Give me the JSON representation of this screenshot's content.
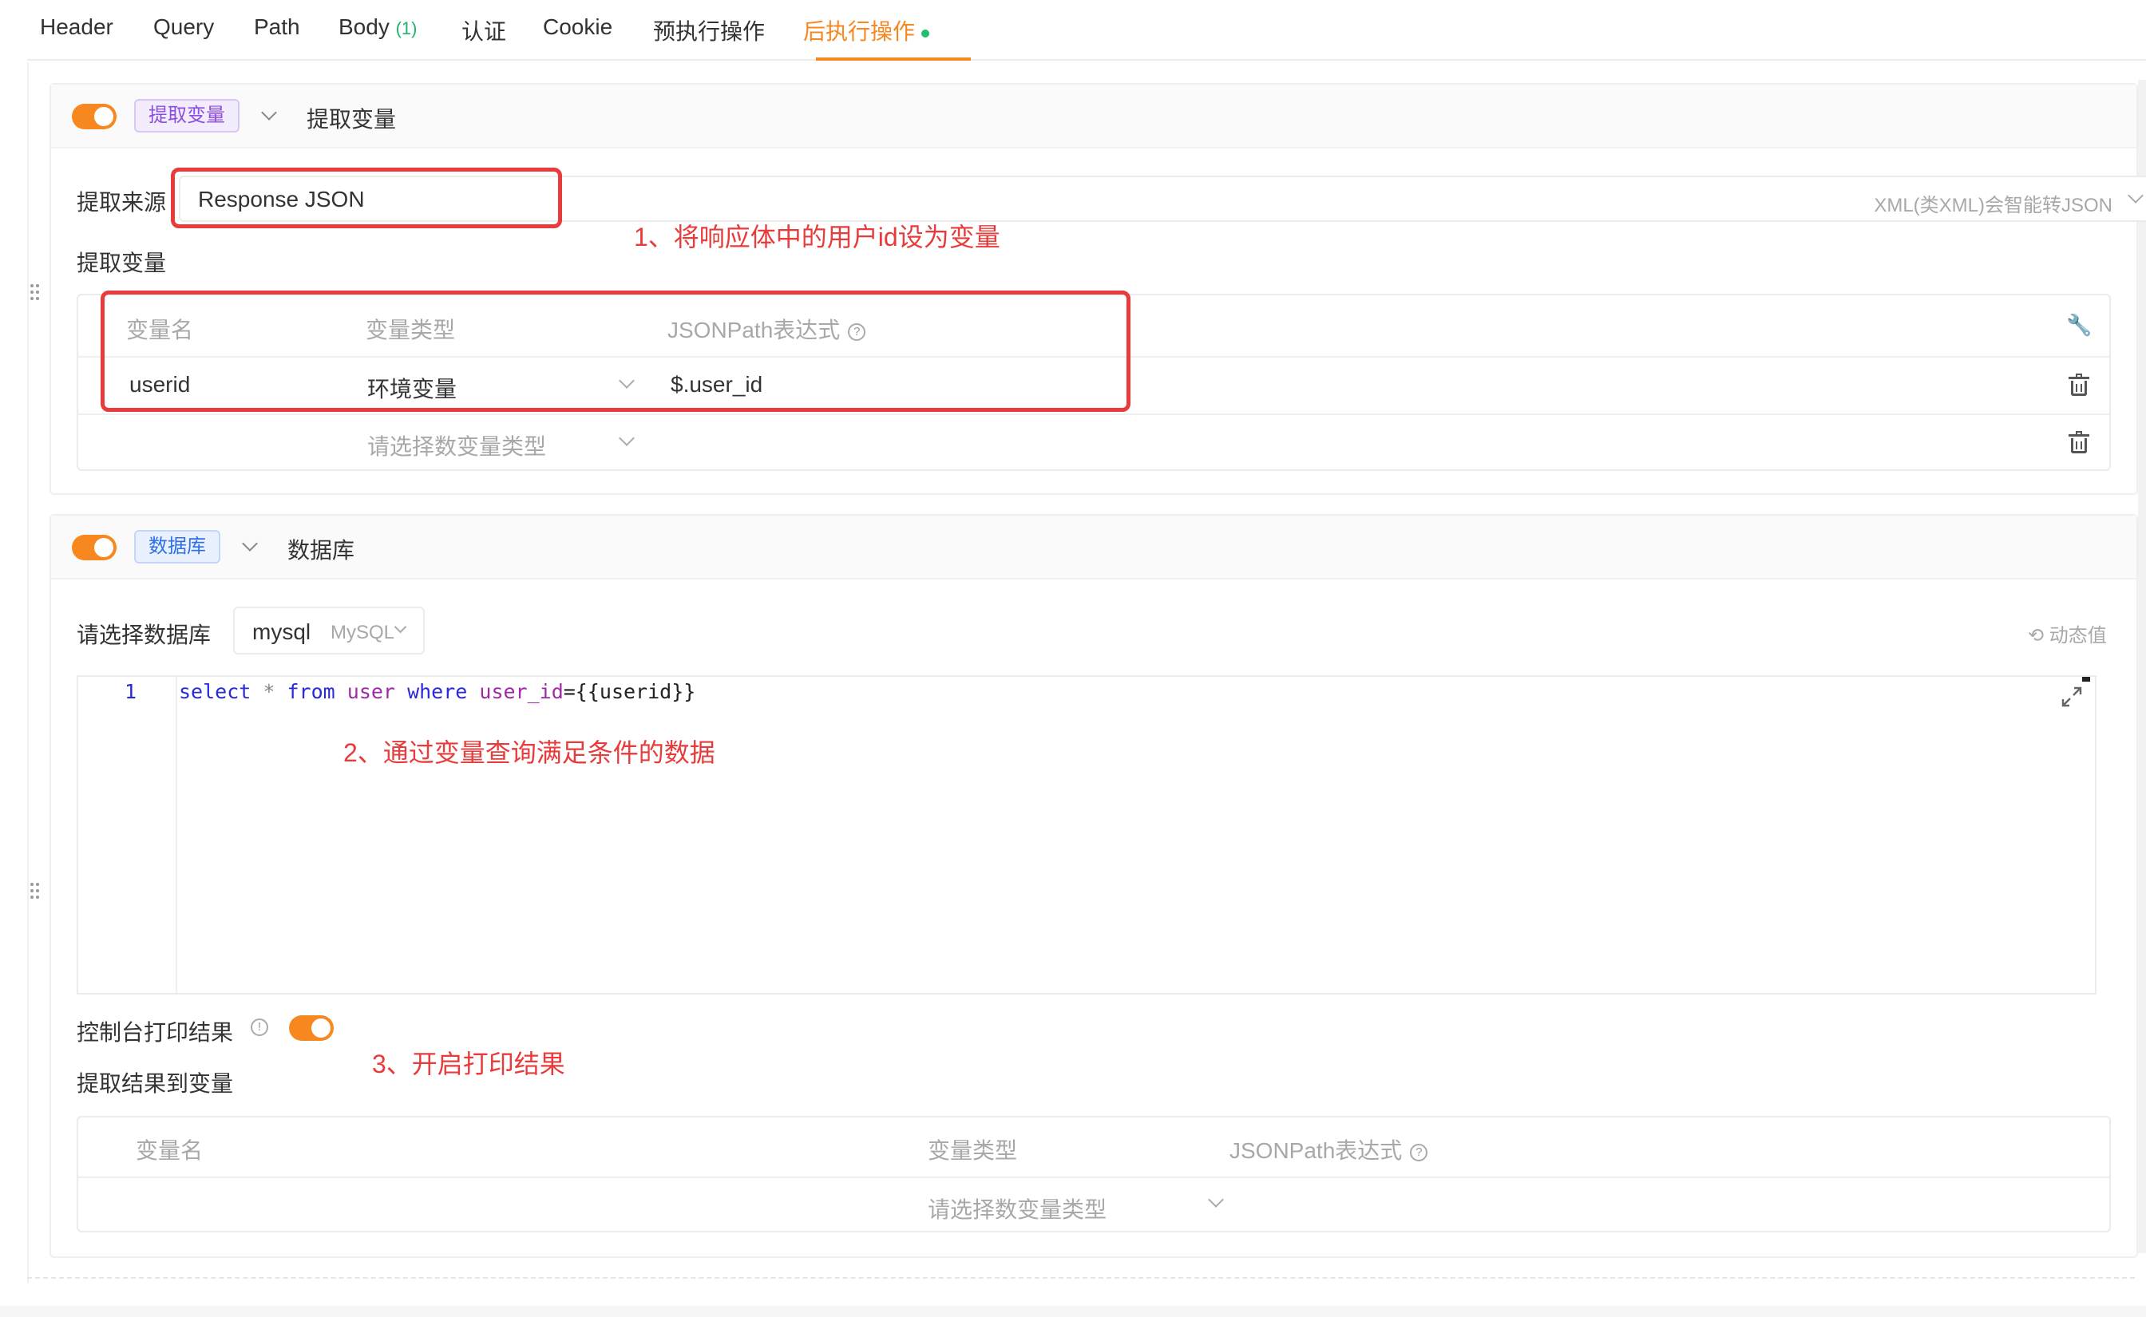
{
  "tabs": [
    {
      "label": "Header"
    },
    {
      "label": "Query"
    },
    {
      "label": "Path"
    },
    {
      "label": "Body",
      "count": "(1)"
    },
    {
      "label": "认证"
    },
    {
      "label": "Cookie"
    },
    {
      "label": "预执行操作"
    },
    {
      "label": "后执行操作",
      "active": true
    }
  ],
  "extract": {
    "tag": "提取变量",
    "title": "提取变量",
    "source_label": "提取来源",
    "source_value": "Response JSON",
    "source_hint": "XML(类XML)会智能转JSON",
    "vars_label": "提取变量",
    "columns": [
      "变量名",
      "变量类型",
      "JSONPath表达式"
    ],
    "rows": [
      {
        "name": "userid",
        "type": "环境变量",
        "path": "$.user_id"
      },
      {
        "name": "",
        "type_placeholder": "请选择数变量类型",
        "path": ""
      }
    ]
  },
  "database": {
    "tag": "数据库",
    "title": "数据库",
    "select_label": "请选择数据库",
    "db_name": "mysql",
    "db_type": "MySQL",
    "dynamic_label": "动态值",
    "line_number": "1",
    "sql": {
      "select": "select",
      "star": "*",
      "from": "from",
      "table": "user",
      "where": "where",
      "col": "user_id",
      "rest": "={{userid}}"
    },
    "print_label": "控制台打印结果",
    "result_label": "提取结果到变量",
    "columns": [
      "变量名",
      "变量类型",
      "JSONPath表达式"
    ],
    "row_type_placeholder": "请选择数变量类型"
  },
  "annotations": {
    "note1": "1、将响应体中的用户id设为变量",
    "note2": "2、通过变量查询满足条件的数据",
    "note3": "3、开启打印结果"
  },
  "colors": {
    "accent": "#f7871f",
    "annotation": "#e83b3b",
    "tag_purple": "#8b4fe0",
    "tag_blue": "#2f6fe6"
  }
}
